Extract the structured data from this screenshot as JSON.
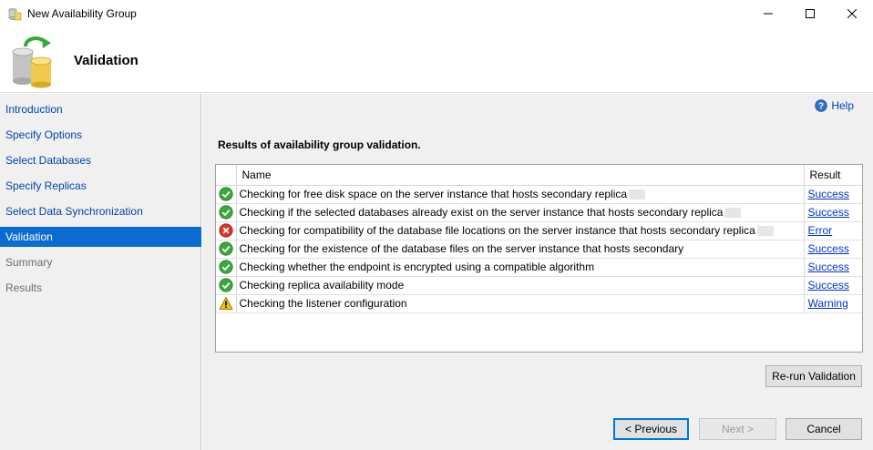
{
  "window": {
    "title": "New Availability Group",
    "controls": {
      "minimize": "minimize",
      "maximize": "maximize",
      "close": "close"
    }
  },
  "header": {
    "title": "Validation",
    "icon": "database-icon"
  },
  "nav": {
    "items": [
      {
        "label": "Introduction",
        "state": "link"
      },
      {
        "label": "Specify Options",
        "state": "link"
      },
      {
        "label": "Select Databases",
        "state": "link"
      },
      {
        "label": "Specify Replicas",
        "state": "link"
      },
      {
        "label": "Select Data Synchronization",
        "state": "link"
      },
      {
        "label": "Validation",
        "state": "active"
      },
      {
        "label": "Summary",
        "state": "disabled"
      },
      {
        "label": "Results",
        "state": "disabled"
      }
    ]
  },
  "main": {
    "help_label": "Help",
    "section_title": "Results of availability group validation.",
    "table": {
      "columns": {
        "name": "Name",
        "result": "Result"
      },
      "rows": [
        {
          "status": "success",
          "name": "Checking for free disk space on the server instance that hosts secondary replica",
          "result": "Success",
          "redacted": true
        },
        {
          "status": "success",
          "name": "Checking if the selected databases already exist on the server instance that hosts secondary replica",
          "result": "Success",
          "redacted": true
        },
        {
          "status": "error",
          "name": "Checking for compatibility of the database file locations on the server instance that hosts secondary replica",
          "result": "Error",
          "redacted": true
        },
        {
          "status": "success",
          "name": "Checking for the existence of the database files on the server instance that hosts secondary",
          "result": "Success",
          "redacted": false
        },
        {
          "status": "success",
          "name": "Checking whether the endpoint is encrypted using a compatible algorithm",
          "result": "Success",
          "redacted": false
        },
        {
          "status": "success",
          "name": "Checking replica availability mode",
          "result": "Success",
          "redacted": false
        },
        {
          "status": "warning",
          "name": "Checking the listener configuration",
          "result": "Warning",
          "redacted": false
        }
      ]
    },
    "buttons": {
      "rerun": "Re-run Validation",
      "previous": "< Previous",
      "next": "Next >",
      "cancel": "Cancel"
    }
  },
  "colors": {
    "nav_active": "#0a6bd0",
    "link": "#0046a8",
    "success": "#3aa83a",
    "error": "#d9362b",
    "warning": "#f2c200"
  }
}
